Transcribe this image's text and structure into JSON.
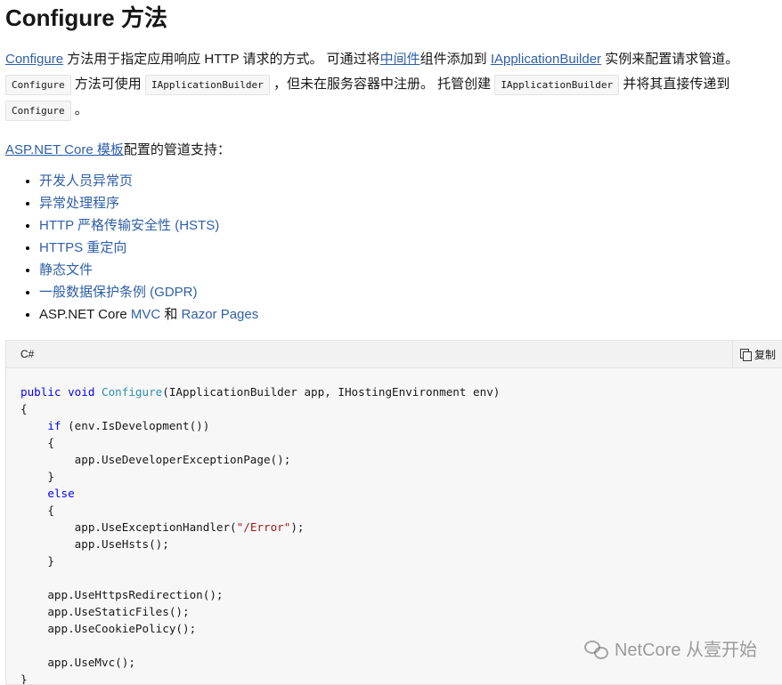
{
  "title": "Configure 方法",
  "intro": {
    "link_configure": "Configure",
    "t1": " 方法用于指定应用响应 HTTP 请求的方式。 可通过将",
    "link_middleware": "中间件",
    "t2": "组件添加到 ",
    "link_iab": "IApplicationBuilder",
    "t3": " 实例来配置请求管道。 ",
    "code1": "Configure",
    "t4": " 方法可使用 ",
    "code2": "IApplicationBuilder",
    "t5": " ，但未在服务容器中注册。 托管创建 ",
    "code3": "IApplicationBuilder",
    "t6": " 并将其直接传递到 ",
    "code4": "Configure",
    "t7": " 。"
  },
  "support": {
    "link": "ASP.NET Core 模板",
    "text": "配置的管道支持："
  },
  "list": {
    "item1": "开发人员异常页",
    "item2": "异常处理程序",
    "item3": "HTTP 严格传输安全性 (HSTS)",
    "item4": "HTTPS 重定向",
    "item5": "静态文件",
    "item6": "一般数据保护条例 (GDPR)",
    "item7_prefix": "ASP.NET Core ",
    "item7_link1": "MVC",
    "item7_mid": " 和 ",
    "item7_link2": "Razor Pages"
  },
  "code": {
    "language": "C#",
    "copy_label": "复制",
    "lines": {
      "l1_kw": "public void ",
      "l1_fn": "Configure",
      "l1_rest": "(IApplicationBuilder app, IHostingEnvironment env)",
      "l2": "{",
      "l3_kw": "if",
      "l3_rest": " (env.IsDevelopment())",
      "l4": "{",
      "l5": "app.UseDeveloperExceptionPage();",
      "l6": "}",
      "l7_kw": "else",
      "l8": "{",
      "l9_a": "app.UseExceptionHandler(",
      "l9_str": "\"/Error\"",
      "l9_b": ");",
      "l10": "app.UseHsts();",
      "l11": "}",
      "l12": "app.UseHttpsRedirection();",
      "l13": "app.UseStaticFiles();",
      "l14": "app.UseCookiePolicy();",
      "l15": "app.UseMvc();",
      "l16": "}"
    }
  },
  "watermark": "NetCore 从壹开始",
  "colors": {
    "link": "#2f5fa8",
    "keyword": "#0101fd",
    "type": "#2b91af",
    "string": "#a31515"
  }
}
